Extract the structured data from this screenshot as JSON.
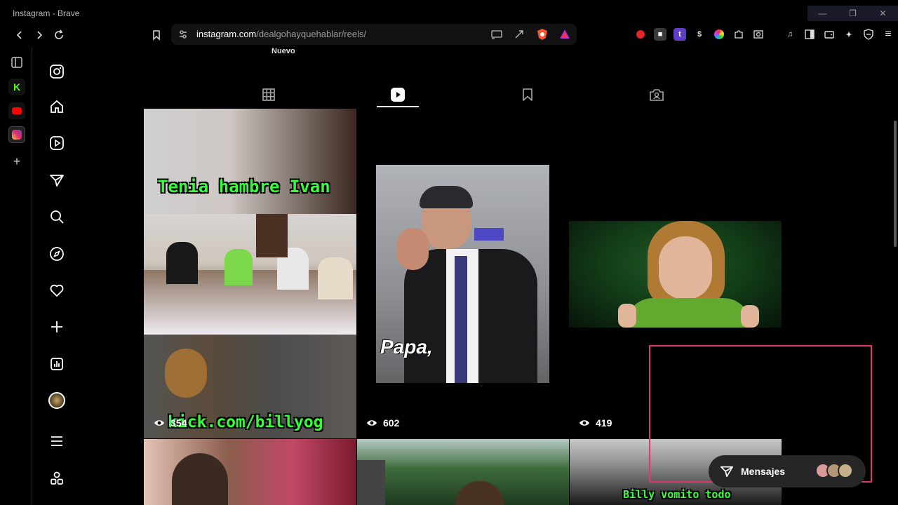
{
  "window": {
    "title": "Instagram - Brave"
  },
  "browser": {
    "url_host": "instagram.com",
    "url_path": "/dealgohayquehablar/reels/"
  },
  "profile": {
    "nuevo_label": "Nuevo"
  },
  "reels": [
    {
      "views": "354",
      "overlay_top": "Tenia hambre Ivan",
      "overlay_bottom": "kick.com/billyog"
    },
    {
      "views": "602",
      "caption": "Papa,"
    },
    {
      "views": "419"
    },
    {},
    {},
    {
      "overlay_bottom": "Billy vomito todo"
    }
  ],
  "messages": {
    "label": "Mensajes"
  },
  "colors": {
    "accent_green": "#34ff3a",
    "selection": "#e0386e"
  }
}
